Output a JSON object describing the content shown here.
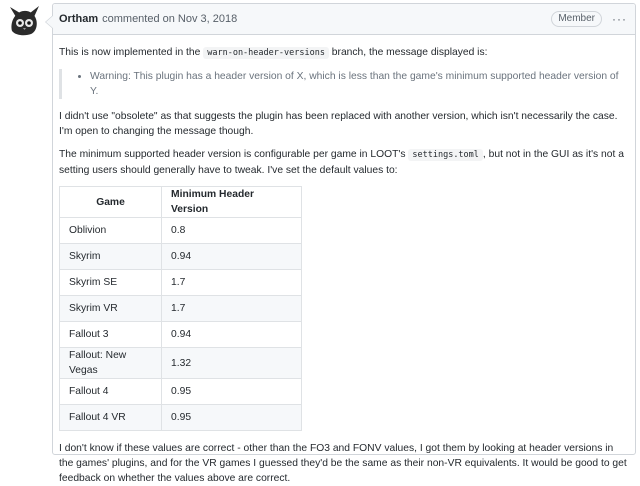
{
  "comment": {
    "author": "Ortham",
    "action": "commented",
    "date": "on Nov 3, 2018",
    "badge": "Member",
    "menu_label": "···"
  },
  "body": {
    "p1_before": "This is now implemented in the ",
    "p1_code": "warn-on-header-versions",
    "p1_after": " branch, the message displayed is:",
    "quote_item": "Warning: This plugin has a header version of X, which is less than the game's minimum supported header version of Y.",
    "p2": "I didn't use \"obsolete\" as that suggests the plugin has been replaced with another version, which isn't necessarily the case. I'm open to changing the message though.",
    "p3_before": "The minimum supported header version is configurable per game in LOOT's ",
    "p3_code": "settings.toml",
    "p3_after": ", but not in the GUI as it's not a setting users should generally have to tweak. I've set the default values to:",
    "p4": "I don't know if these values are correct - other than the FO3 and FONV values, I got them by looking at header versions in the games' plugins, and for the VR games I guessed they'd be the same as their non-VR equivalents. It would be good to get feedback on whether the values above are correct."
  },
  "table": {
    "headers": [
      "Game",
      "Minimum Header Version"
    ],
    "rows": [
      [
        "Oblivion",
        "0.8"
      ],
      [
        "Skyrim",
        "0.94"
      ],
      [
        "Skyrim SE",
        "1.7"
      ],
      [
        "Skyrim VR",
        "1.7"
      ],
      [
        "Fallout 3",
        "0.94"
      ],
      [
        "Fallout: New Vegas",
        "1.32"
      ],
      [
        "Fallout 4",
        "0.95"
      ],
      [
        "Fallout 4 VR",
        "0.95"
      ]
    ]
  }
}
